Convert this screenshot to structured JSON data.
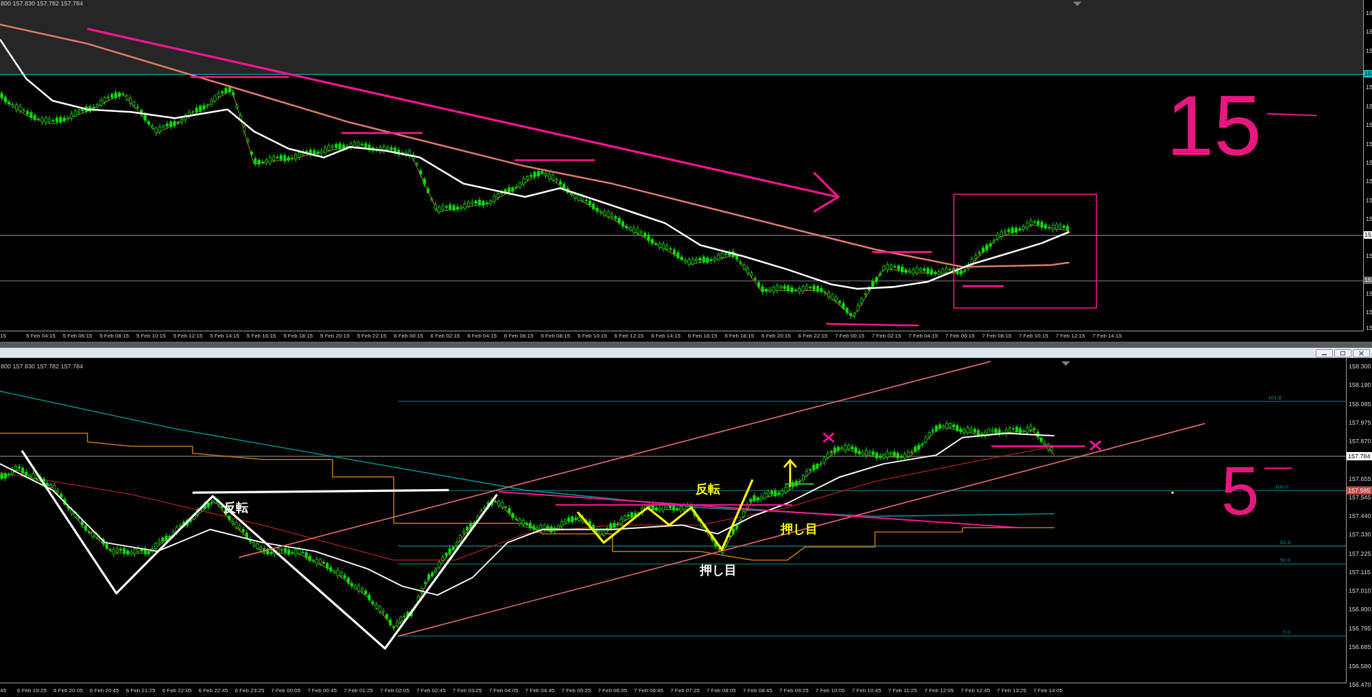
{
  "top_chart": {
    "ohlc_header": "800 157.830 157.782 157.784",
    "price_axis": [
      "16",
      "16",
      "15",
      "15",
      "15",
      "15",
      "15",
      "15",
      "15",
      "15",
      "15",
      "15",
      "15",
      "15",
      "15"
    ],
    "price_tags": [
      {
        "label": "15",
        "color": "#00c0c0"
      },
      {
        "label": "15",
        "color": "#ffffff"
      },
      {
        "label": "15",
        "color": "#606060"
      }
    ],
    "time_axis": [
      "15",
      "5 Feb 04:15",
      "5 Feb 06:15",
      "5 Feb 08:15",
      "5 Feb 10:15",
      "5 Feb 12:15",
      "5 Feb 14:15",
      "5 Feb 16:15",
      "5 Feb 18:15",
      "5 Feb 20:15",
      "5 Feb 22:15",
      "6 Feb 00:15",
      "6 Feb 02:15",
      "6 Feb 04:15",
      "6 Feb 06:15",
      "6 Feb 08:15",
      "6 Feb 10:15",
      "6 Feb 12:15",
      "6 Feb 14:15",
      "6 Feb 16:15",
      "6 Feb 18:15",
      "6 Feb 20:15",
      "6 Feb 22:15",
      "7 Feb 00:15",
      "7 Feb 02:15",
      "7 Feb 04:15",
      "7 Feb 06:15",
      "7 Feb 08:15",
      "7 Feb 10:15",
      "7 Feb 12:15",
      "7 Feb 14:15"
    ],
    "annotations": [
      {
        "text": "15",
        "color": "#e8177f"
      }
    ]
  },
  "bottom_chart": {
    "ohlc_header": "800 157.830 157.782 157.784",
    "price_axis": [
      "158.300",
      "158.190",
      "158.085",
      "157.975",
      "157.870",
      "157.655",
      "157.545",
      "157.440",
      "157.330",
      "157.225",
      "157.115",
      "157.010",
      "156.900",
      "156.795",
      "156.685",
      "156.580",
      "156.470"
    ],
    "price_tags": [
      {
        "label": "157.784",
        "color": "#ffffff"
      },
      {
        "label": "157.585",
        "color": "#c04848"
      }
    ],
    "fib_levels": [
      "161.8",
      "100.0",
      "61.8",
      "50.0",
      "0.0"
    ],
    "time_axis": [
      "45",
      "6 Feb 19:25",
      "6 Feb 20:05",
      "6 Feb 20:45",
      "6 Feb 21:25",
      "6 Feb 22:05",
      "6 Feb 22:45",
      "6 Feb 23:25",
      "7 Feb 00:05",
      "7 Feb 00:45",
      "7 Feb 01:25",
      "7 Feb 02:05",
      "7 Feb 02:45",
      "7 Feb 03:25",
      "7 Feb 04:05",
      "7 Feb 04:45",
      "7 Feb 05:25",
      "7 Feb 06:05",
      "7 Feb 06:45",
      "7 Feb 07:25",
      "7 Feb 08:05",
      "7 Feb 08:45",
      "7 Feb 09:25",
      "7 Feb 10:05",
      "7 Feb 10:45",
      "7 Feb 11:25",
      "7 Feb 12:05",
      "7 Feb 12:45",
      "7 Feb 13:25",
      "7 Feb 14:05"
    ],
    "annotations": [
      {
        "text": "反転",
        "color": "#ffffff"
      },
      {
        "text": "反転",
        "color": "#ffff00"
      },
      {
        "text": "押し目",
        "color": "#ffff00"
      },
      {
        "text": "押し目",
        "color": "#ffffff"
      },
      {
        "text": "5",
        "color": "#e8177f"
      }
    ]
  }
}
